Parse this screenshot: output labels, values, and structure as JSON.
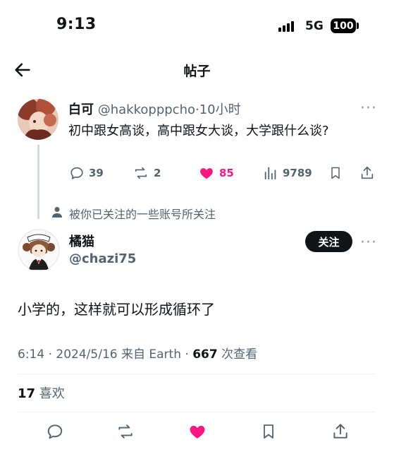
{
  "status_bar": {
    "time": "9:13",
    "network": "5G",
    "battery": "100"
  },
  "header": {
    "title": "帖子"
  },
  "quoted_post": {
    "display_name": "白可",
    "handle": "@hakkopppcho",
    "separator": "·",
    "time_ago": "10小时",
    "text": "初中跟女高谈，高中跟女大谈，大学跟什么谈?",
    "actions": {
      "replies": "39",
      "reposts": "2",
      "likes": "85",
      "views": "9789"
    },
    "colors": {
      "like": "#f91880"
    }
  },
  "social_context": {
    "text": "被你已关注的一些账号所关注"
  },
  "main_post": {
    "display_name": "橘猫",
    "handle": "@chazi75",
    "follow_label": "关注",
    "text": "小学的，这样就可以形成循环了",
    "time": "6:14",
    "date": "2024/5/16",
    "source": "来自 Earth",
    "views_count": "667",
    "views_label": "次查看",
    "likes_count": "17",
    "likes_label": "喜欢"
  },
  "icons": [
    "back-arrow-icon",
    "reply-icon",
    "repost-icon",
    "like-icon",
    "views-icon",
    "bookmark-icon",
    "share-icon",
    "person-icon",
    "more-icon"
  ]
}
